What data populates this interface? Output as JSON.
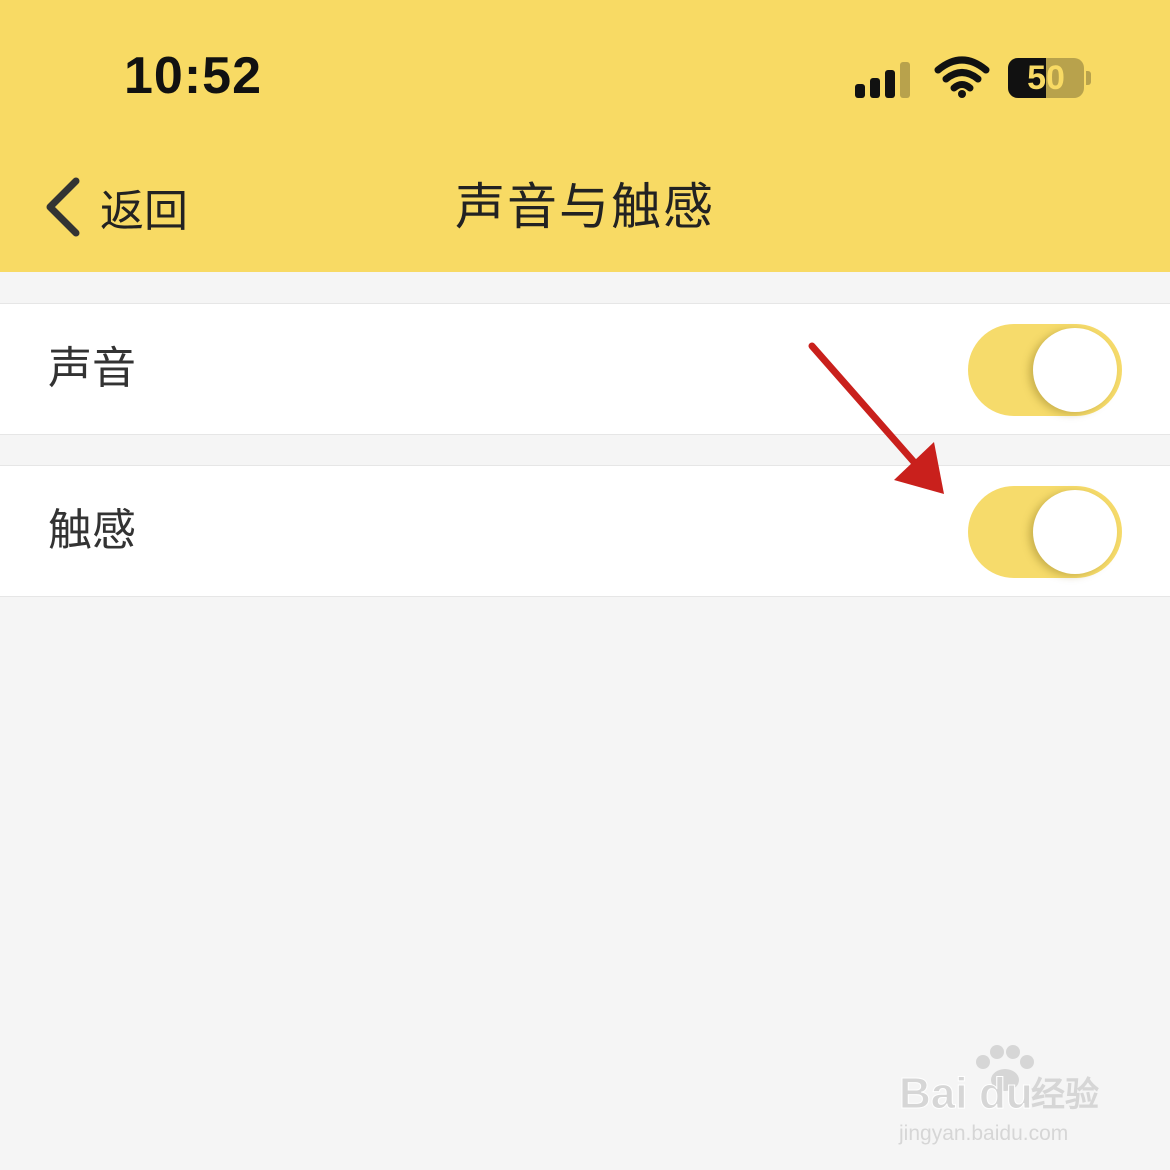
{
  "status_bar": {
    "time": "10:52",
    "battery": "50"
  },
  "nav": {
    "back_label": "返回",
    "title": "声音与触感"
  },
  "settings": [
    {
      "label": "声音",
      "enabled": true
    },
    {
      "label": "触感",
      "enabled": true
    }
  ],
  "watermark": {
    "brand": "Bai du 经验",
    "url": "jingyan.baidu.com"
  },
  "colors": {
    "header_bg": "#f8da64",
    "toggle_on": "#f6db6b",
    "page_bg": "#f5f5f5",
    "annotation_arrow": "#c9201c"
  },
  "icons": {
    "back": "chevron-left-icon",
    "signal": "signal-strength-icon",
    "wifi": "wifi-icon",
    "battery": "battery-icon",
    "annotation": "red-arrow-icon"
  }
}
